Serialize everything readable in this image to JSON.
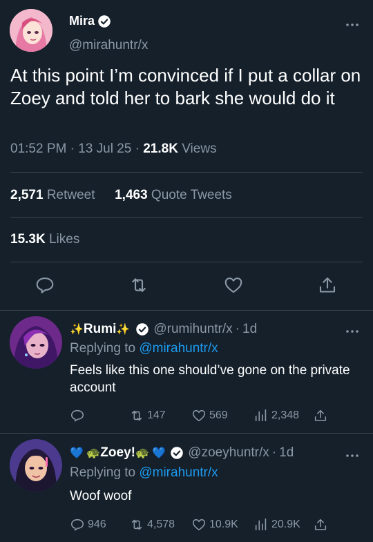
{
  "main_tweet": {
    "display_name": "Mira",
    "handle": "@mirahuntr/x",
    "text": "At this point I’m convinced if I put a collar on Zoey and told her to bark she would do it",
    "time": "01:52 PM",
    "date": "13 Jul 25",
    "views_count": "21.8K",
    "views_label": "Views",
    "retweet_count": "2,571",
    "retweet_label": "Retweet",
    "quote_count": "1,463",
    "quote_label": "Quote Tweets",
    "likes_count": "15.3K",
    "likes_label": "Likes"
  },
  "replies": [
    {
      "name_prefix": "✨ ",
      "display_name": "Rumi",
      "name_suffix": "✨",
      "handle": "@rumihuntr/x",
      "age": "1d",
      "replying_label": "Replying to",
      "replying_to": "@mirahuntr/x",
      "text": "Feels like this one should’ve gone on the private account",
      "replies_count": "",
      "retweets": "147",
      "likes": "569",
      "views": "2,348"
    },
    {
      "name_prefix": "💙 🐢 ",
      "display_name": "Zoey!",
      "name_suffix": "🐢 💙",
      "handle": "@zoeyhuntr/x",
      "age": "1d",
      "replying_label": "Replying to",
      "replying_to": "@mirahuntr/x",
      "text": "Woof woof",
      "replies_count": "946",
      "retweets": "4,578",
      "likes": "10.9K",
      "views": "20.9K"
    }
  ],
  "colors": {
    "background": "#15202b",
    "muted": "#8b98a5",
    "accent": "#1d9bf0",
    "divider": "#38444d"
  },
  "icons": [
    "verified-badge-icon",
    "more-icon",
    "reply-icon",
    "retweet-icon",
    "like-icon",
    "share-icon",
    "views-icon"
  ]
}
